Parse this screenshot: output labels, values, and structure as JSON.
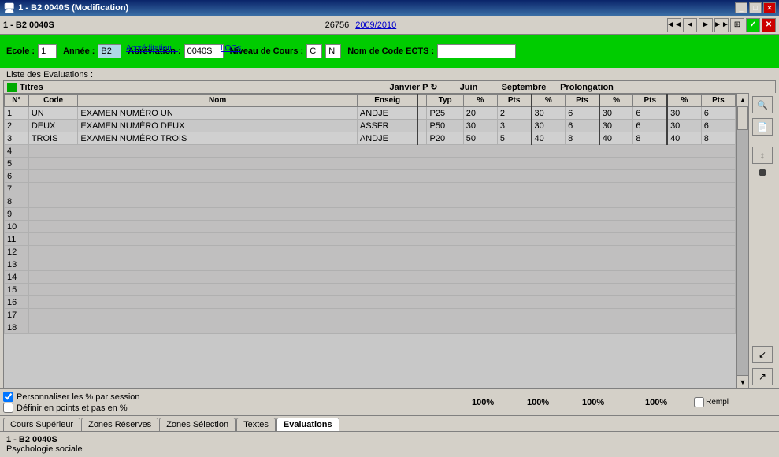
{
  "titleBar": {
    "title": "1 - B2  0040S  (Modification)",
    "controls": [
      "_",
      "□",
      "✕"
    ]
  },
  "menuBar": {
    "left": "1 - B2   0040S",
    "center": "26756",
    "year": "2009/2010",
    "navButtons": [
      "◄◄",
      "◄",
      "►",
      "►►",
      "⊞",
      "✓",
      "✕"
    ]
  },
  "formBar": {
    "ecoleLabel": "Ecole :",
    "ecoleValue": "1",
    "anneeLabel": "Année :",
    "anneeValue": "B2",
    "abbreviationLabel": "Abréviation :",
    "abbreviationValue": "0040S",
    "niveauLabel": "Niveau de Cours :",
    "niveauValue1": "C",
    "niveauValue2": "N",
    "nomCodeLabel": "Nom de Code ECTS :",
    "nomCodeValue": "",
    "link1": "Accréditation...",
    "link2": "LOGs"
  },
  "listLabel": "Liste des Evaluations :",
  "tableHeader": {
    "titresLabel": "Titres",
    "sessions": [
      {
        "name": "Janvier P",
        "icon": "↻"
      },
      {
        "name": "Juin"
      },
      {
        "name": "Septembre"
      },
      {
        "name": "Prolongation"
      }
    ]
  },
  "tableColumns": {
    "headers": [
      "N°",
      "Code",
      "Nom",
      "Enseig",
      "",
      "Typ",
      "%",
      "Pts",
      "%",
      "Pts",
      "%",
      "Pts",
      "%",
      "Pts"
    ]
  },
  "tableRows": [
    {
      "num": "1",
      "code": "UN",
      "nom": "EXAMEN NUMÉRO UN",
      "enseig": "ANDJE",
      "typ": "P25",
      "pct1": "20",
      "pts1": "2",
      "pct2": "30",
      "pts2": "6",
      "pct3": "30",
      "pts3": "6",
      "pct4": "30",
      "pts4": "6"
    },
    {
      "num": "2",
      "code": "DEUX",
      "nom": "EXAMEN NUMÉRO DEUX",
      "enseig": "ASSFR",
      "typ": "P50",
      "pct1": "30",
      "pts1": "3",
      "pct2": "30",
      "pts2": "6",
      "pct3": "30",
      "pts3": "6",
      "pct4": "30",
      "pts4": "6"
    },
    {
      "num": "3",
      "code": "TROIS",
      "nom": "EXAMEN NUMÉRO TROIS",
      "enseig": "ANDJE",
      "typ": "P20",
      "pct1": "50",
      "pts1": "5",
      "pct2": "40",
      "pts2": "8",
      "pct3": "40",
      "pts3": "8",
      "pct4": "40",
      "pts4": "8"
    },
    {
      "num": "4"
    },
    {
      "num": "5"
    },
    {
      "num": "6"
    },
    {
      "num": "7"
    },
    {
      "num": "8"
    },
    {
      "num": "9"
    },
    {
      "num": "10"
    },
    {
      "num": "11"
    },
    {
      "num": "12"
    },
    {
      "num": "13"
    },
    {
      "num": "14"
    },
    {
      "num": "15"
    },
    {
      "num": "16"
    },
    {
      "num": "17"
    },
    {
      "num": "18"
    }
  ],
  "percentages": {
    "label": "",
    "jan": "100%",
    "juin": "100%",
    "sept": "100%",
    "prol": "100%"
  },
  "checkboxes": [
    {
      "id": "cb1",
      "label": "Personnaliser les % par session",
      "checked": true
    },
    {
      "id": "cb2",
      "label": "Définir en points et pas en %",
      "checked": false
    }
  ],
  "tabs": [
    {
      "label": "Cours Supérieur",
      "active": false
    },
    {
      "label": "Zones Réserves",
      "active": false
    },
    {
      "label": "Zones Sélection",
      "active": false
    },
    {
      "label": "Textes",
      "active": false
    },
    {
      "label": "Evaluations",
      "active": true
    }
  ],
  "footer": {
    "line1": "1 - B2   0040S",
    "line2": "Psychologie sociale"
  },
  "remplLabel": "Rempl",
  "sideButtons": {
    "magnify": "🔍",
    "print": "🖨",
    "sort": "↕",
    "dot": "•",
    "arrowDown": "↙",
    "arrowRight": "↗"
  }
}
